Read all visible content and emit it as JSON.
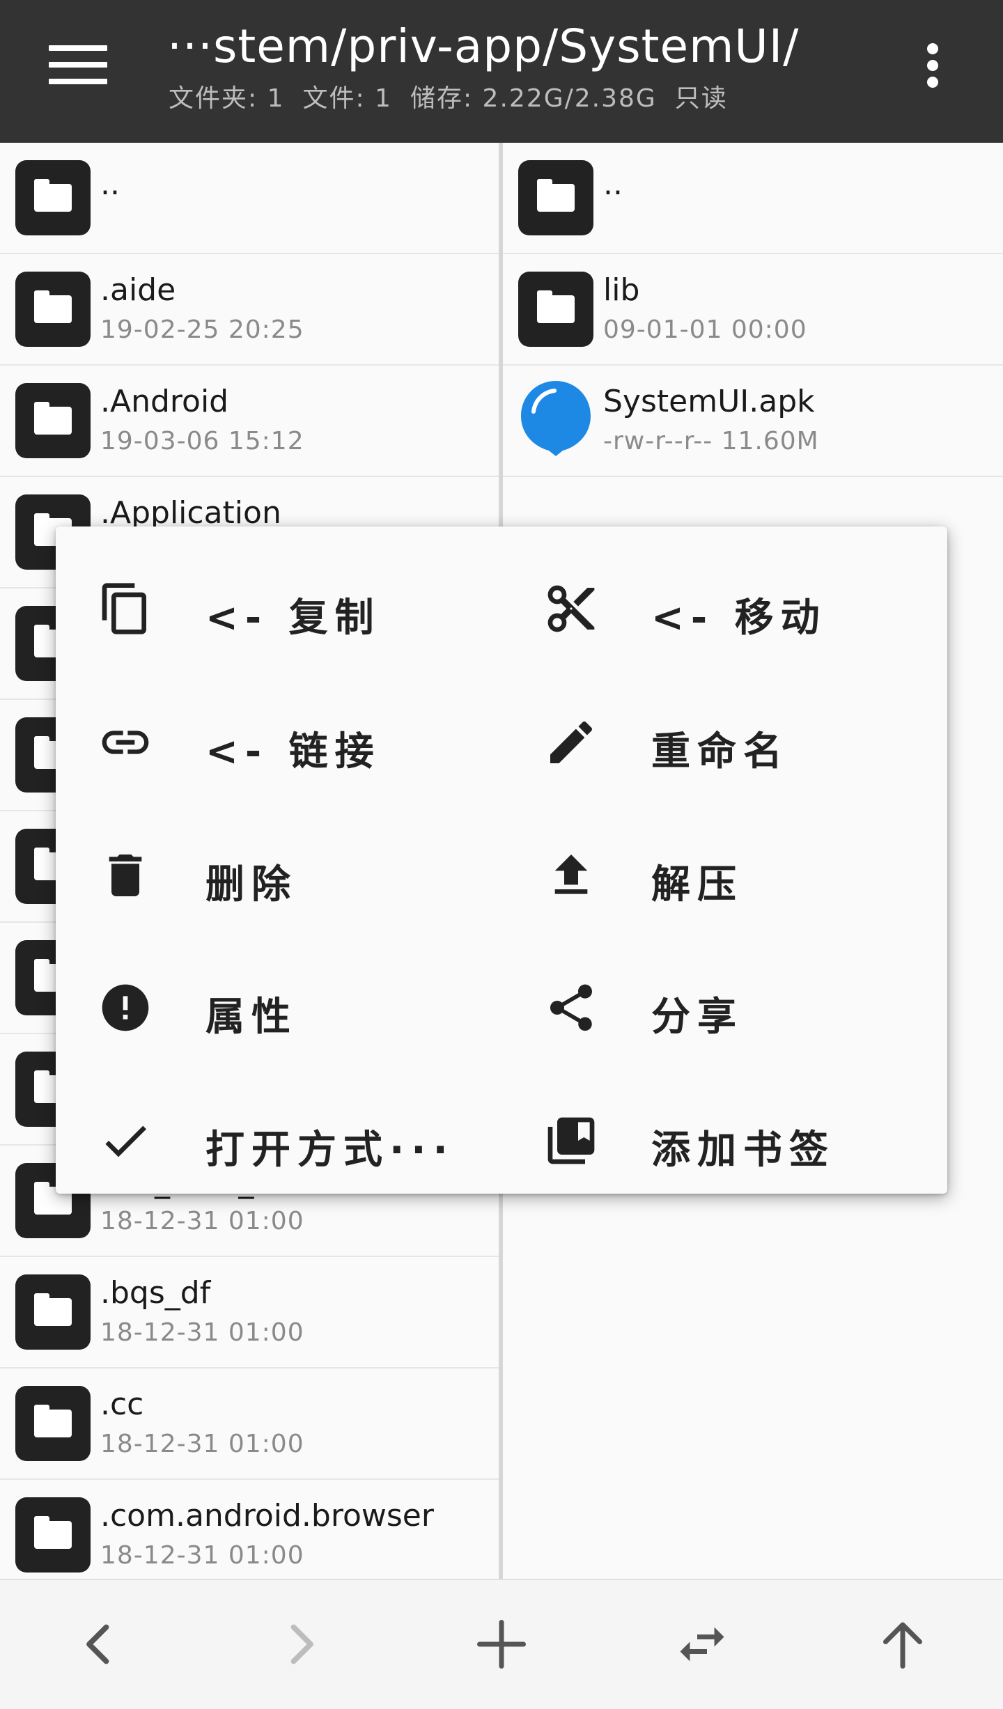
{
  "header": {
    "path": "···stem/priv-app/SystemUI/",
    "folders": "文件夹: 1",
    "files": "文件: 1",
    "storage": "储存: 2.22G/2.38G",
    "mode": "只读"
  },
  "left_pane": {
    "rows": [
      {
        "name": "..",
        "meta": ""
      },
      {
        "name": ".aide",
        "meta": "19-02-25 20:25"
      },
      {
        "name": ".Android",
        "meta": "19-03-06 15:12"
      },
      {
        "name": ".Application",
        "meta": ""
      },
      {
        "name": "",
        "meta": ""
      },
      {
        "name": "",
        "meta": ""
      },
      {
        "name": "",
        "meta": ""
      },
      {
        "name": "",
        "meta": ""
      },
      {
        "name": "",
        "meta": ""
      },
      {
        "name": ".BD_SAPI_CACHE",
        "meta": "18-12-31 01:00"
      },
      {
        "name": ".bqs_df",
        "meta": "18-12-31 01:00"
      },
      {
        "name": ".cc",
        "meta": "18-12-31 01:00"
      },
      {
        "name": ".com.android.browser",
        "meta": "18-12-31 01:00"
      }
    ]
  },
  "right_pane": {
    "rows": [
      {
        "name": "..",
        "meta": ""
      },
      {
        "name": "lib",
        "meta": "09-01-01 00:00"
      },
      {
        "name": "SystemUI.apk",
        "meta": "-rw-r--r--   11.60M"
      }
    ]
  },
  "context_menu": {
    "copy": "<- 复制",
    "move": "<- 移动",
    "link": "<- 链接",
    "rename": "重命名",
    "delete": "删除",
    "extract": "解压",
    "properties": "属性",
    "share": "分享",
    "open_with": "打开方式···",
    "bookmark": "添加书签"
  },
  "icons": {
    "menu": "hamburger-menu-icon",
    "more": "more-vert-icon",
    "folder": "folder-icon",
    "apk": "apk-app-icon",
    "back": "chevron-left-icon",
    "forward": "chevron-right-icon",
    "add": "plus-icon",
    "swap": "swap-icon",
    "up": "arrow-up-icon"
  },
  "colors": {
    "topbar": "#333333",
    "apk_blue": "#1e88e5"
  }
}
